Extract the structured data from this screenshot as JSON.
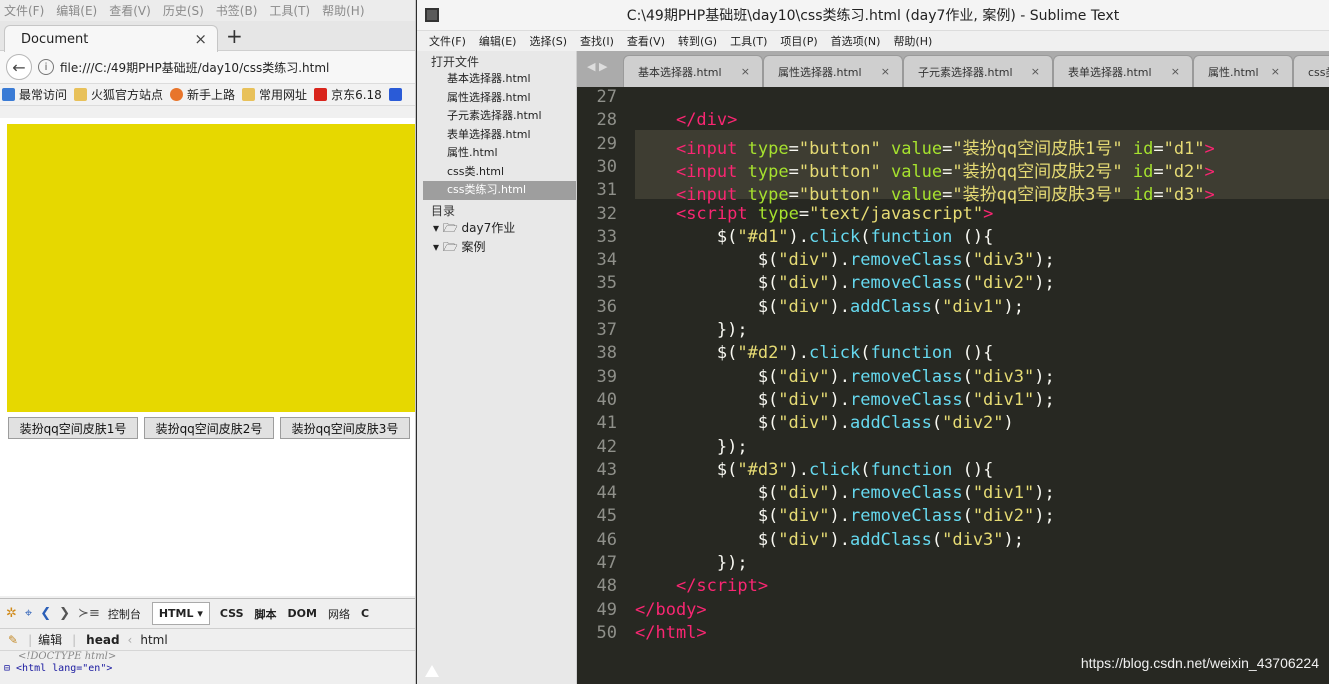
{
  "firefox": {
    "menu": [
      "文件(F)",
      "编辑(E)",
      "查看(V)",
      "历史(S)",
      "书签(B)",
      "工具(T)",
      "帮助(H)"
    ],
    "tab_title": "Document",
    "tab_close": "×",
    "new_tab": "+",
    "url": "file:///C:/49期PHP基础班/day10/css类练习.html",
    "bookmarks": [
      "最常访问",
      "火狐官方站点",
      "新手上路",
      "常用网址",
      "京东6.18"
    ],
    "buttons": [
      "装扮qq空间皮肤1号",
      "装扮qq空间皮肤2号",
      "装扮qq空间皮肤3号"
    ],
    "box_color": "#e6d800",
    "devtools": {
      "tabs": [
        "控制台",
        "HTML ▾",
        "CSS",
        "脚本",
        "DOM",
        "网络",
        "C"
      ],
      "edit": "编辑",
      "path_head": "head",
      "path_html": "html",
      "doctype": "<!DOCTYPE html>",
      "html_line": "⊟ <html lang=\"en\">"
    }
  },
  "sublime": {
    "title": "C:\\49期PHP基础班\\day10\\css类练习.html (day7作业, 案例) - Sublime Text",
    "menu": [
      "文件(F)",
      "编辑(E)",
      "选择(S)",
      "查找(I)",
      "查看(V)",
      "转到(G)",
      "工具(T)",
      "项目(P)",
      "首选项(N)",
      "帮助(H)"
    ],
    "sidebar": {
      "open_files_header": "打开文件",
      "open_files": [
        "基本选择器.html",
        "属性选择器.html",
        "子元素选择器.html",
        "表单选择器.html",
        "属性.html",
        "css类.html",
        "css类练习.html"
      ],
      "folders_header": "目录",
      "folders": [
        "day7作业",
        "案例"
      ]
    },
    "tabs": [
      "基本选择器.html",
      "属性选择器.html",
      "子元素选择器.html",
      "表单选择器.html",
      "属性.html",
      "css类"
    ],
    "line_numbers": [
      "27",
      "28",
      "29",
      "30",
      "31",
      "32",
      "33",
      "34",
      "35",
      "36",
      "37",
      "38",
      "39",
      "40",
      "41",
      "42",
      "43",
      "44",
      "45",
      "46",
      "47",
      "48",
      "49",
      "50"
    ]
  },
  "watermark": "https://blog.csdn.net/weixin_43706224"
}
